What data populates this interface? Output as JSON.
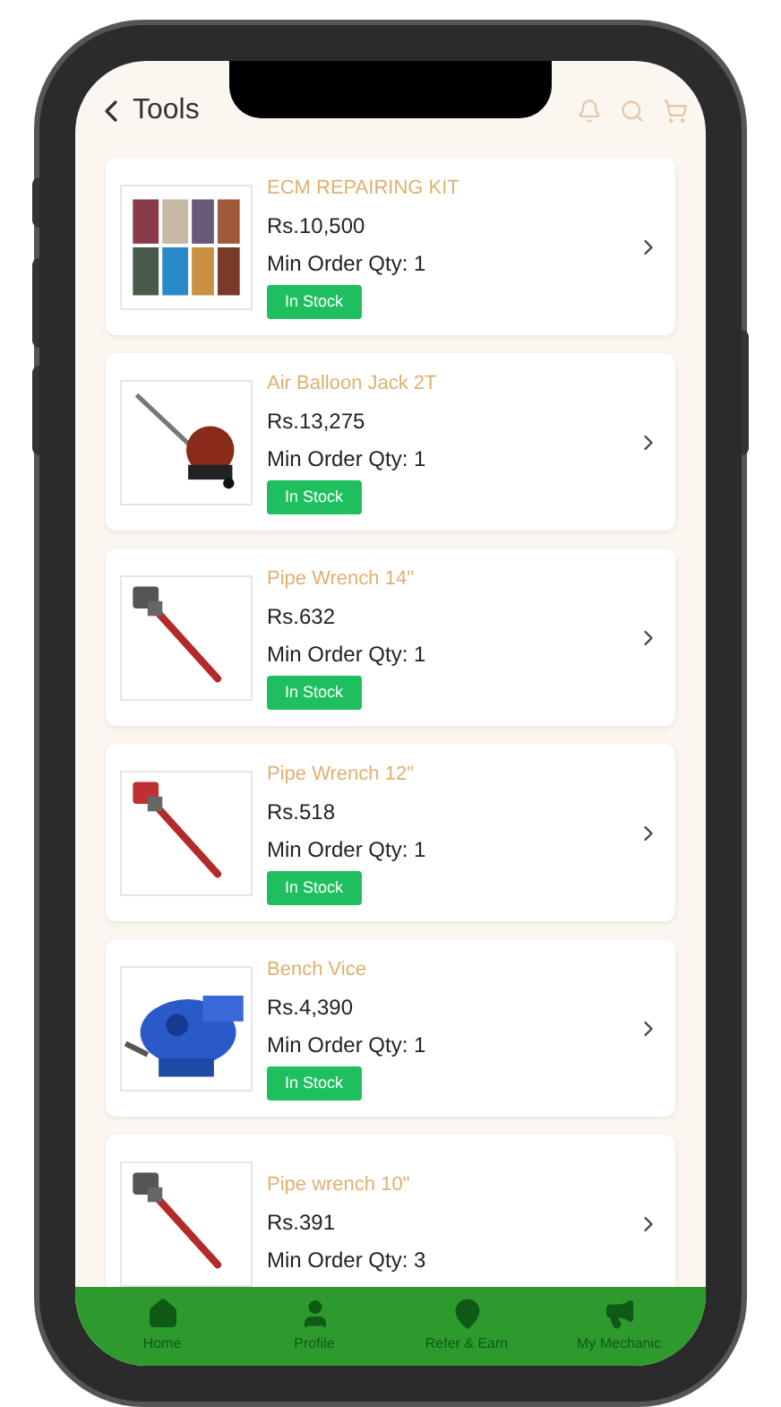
{
  "header": {
    "title": "Tools"
  },
  "products": [
    {
      "name": "ECM REPAIRING KIT",
      "price": "Rs.10,500",
      "min_order": "Min Order Qty: 1",
      "badge": "In Stock"
    },
    {
      "name": "Air Balloon Jack 2T",
      "price": "Rs.13,275",
      "min_order": "Min Order Qty: 1",
      "badge": "In Stock"
    },
    {
      "name": "Pipe Wrench 14\"",
      "price": "Rs.632",
      "min_order": "Min Order Qty: 1",
      "badge": "In Stock"
    },
    {
      "name": "Pipe Wrench 12\"",
      "price": "Rs.518",
      "min_order": "Min Order Qty: 1",
      "badge": "In Stock"
    },
    {
      "name": "Bench Vice",
      "price": "Rs.4,390",
      "min_order": "Min Order Qty: 1",
      "badge": "In Stock"
    },
    {
      "name": "Pipe wrench 10\"",
      "price": "Rs.391",
      "min_order": "Min Order Qty: 3"
    }
  ],
  "bottom_nav": [
    {
      "label": "Home",
      "kind": "home"
    },
    {
      "label": "Profile",
      "kind": "user"
    },
    {
      "label": "Refer & Earn",
      "kind": "pin"
    },
    {
      "label": "My Mechanic",
      "kind": "megaphone"
    }
  ]
}
